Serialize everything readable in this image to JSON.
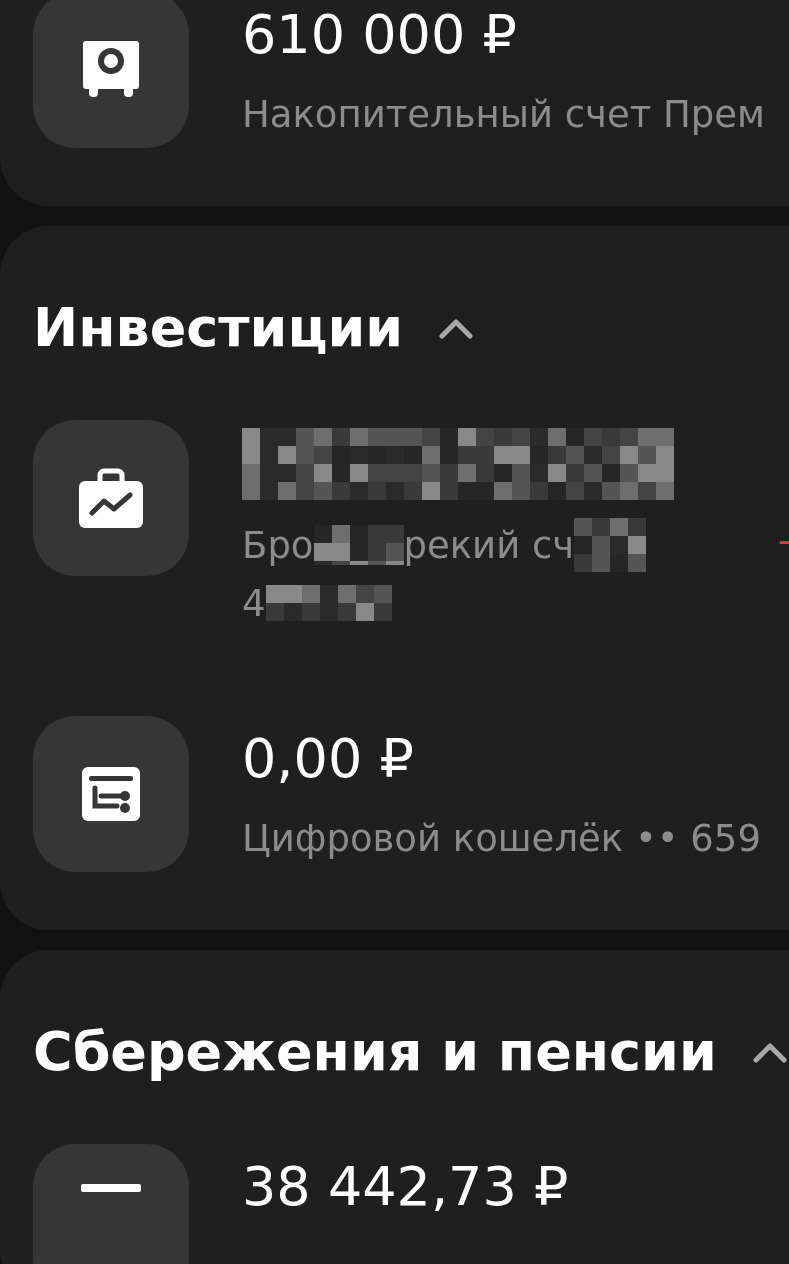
{
  "sections": [
    {
      "rows": [
        {
          "kind": "savings",
          "amount": "610 000 ₽",
          "subtitle": "Накопительный счет Прем"
        }
      ]
    },
    {
      "title": "Инвестиции",
      "expanded": true,
      "rows": [
        {
          "kind": "brokerage",
          "amount_hidden": true,
          "subtitle_parts": [
            "Бро",
            "рекий сч"
          ],
          "number_part": "4",
          "change": "-"
        },
        {
          "kind": "wallet",
          "amount": "0,00 ₽",
          "subtitle": "Цифровой кошелёк •• 659"
        }
      ]
    },
    {
      "title": "Сбережения и пенсии",
      "expanded": true,
      "rows": [
        {
          "kind": "pension",
          "amount": "38 442,73 ₽"
        }
      ]
    }
  ]
}
